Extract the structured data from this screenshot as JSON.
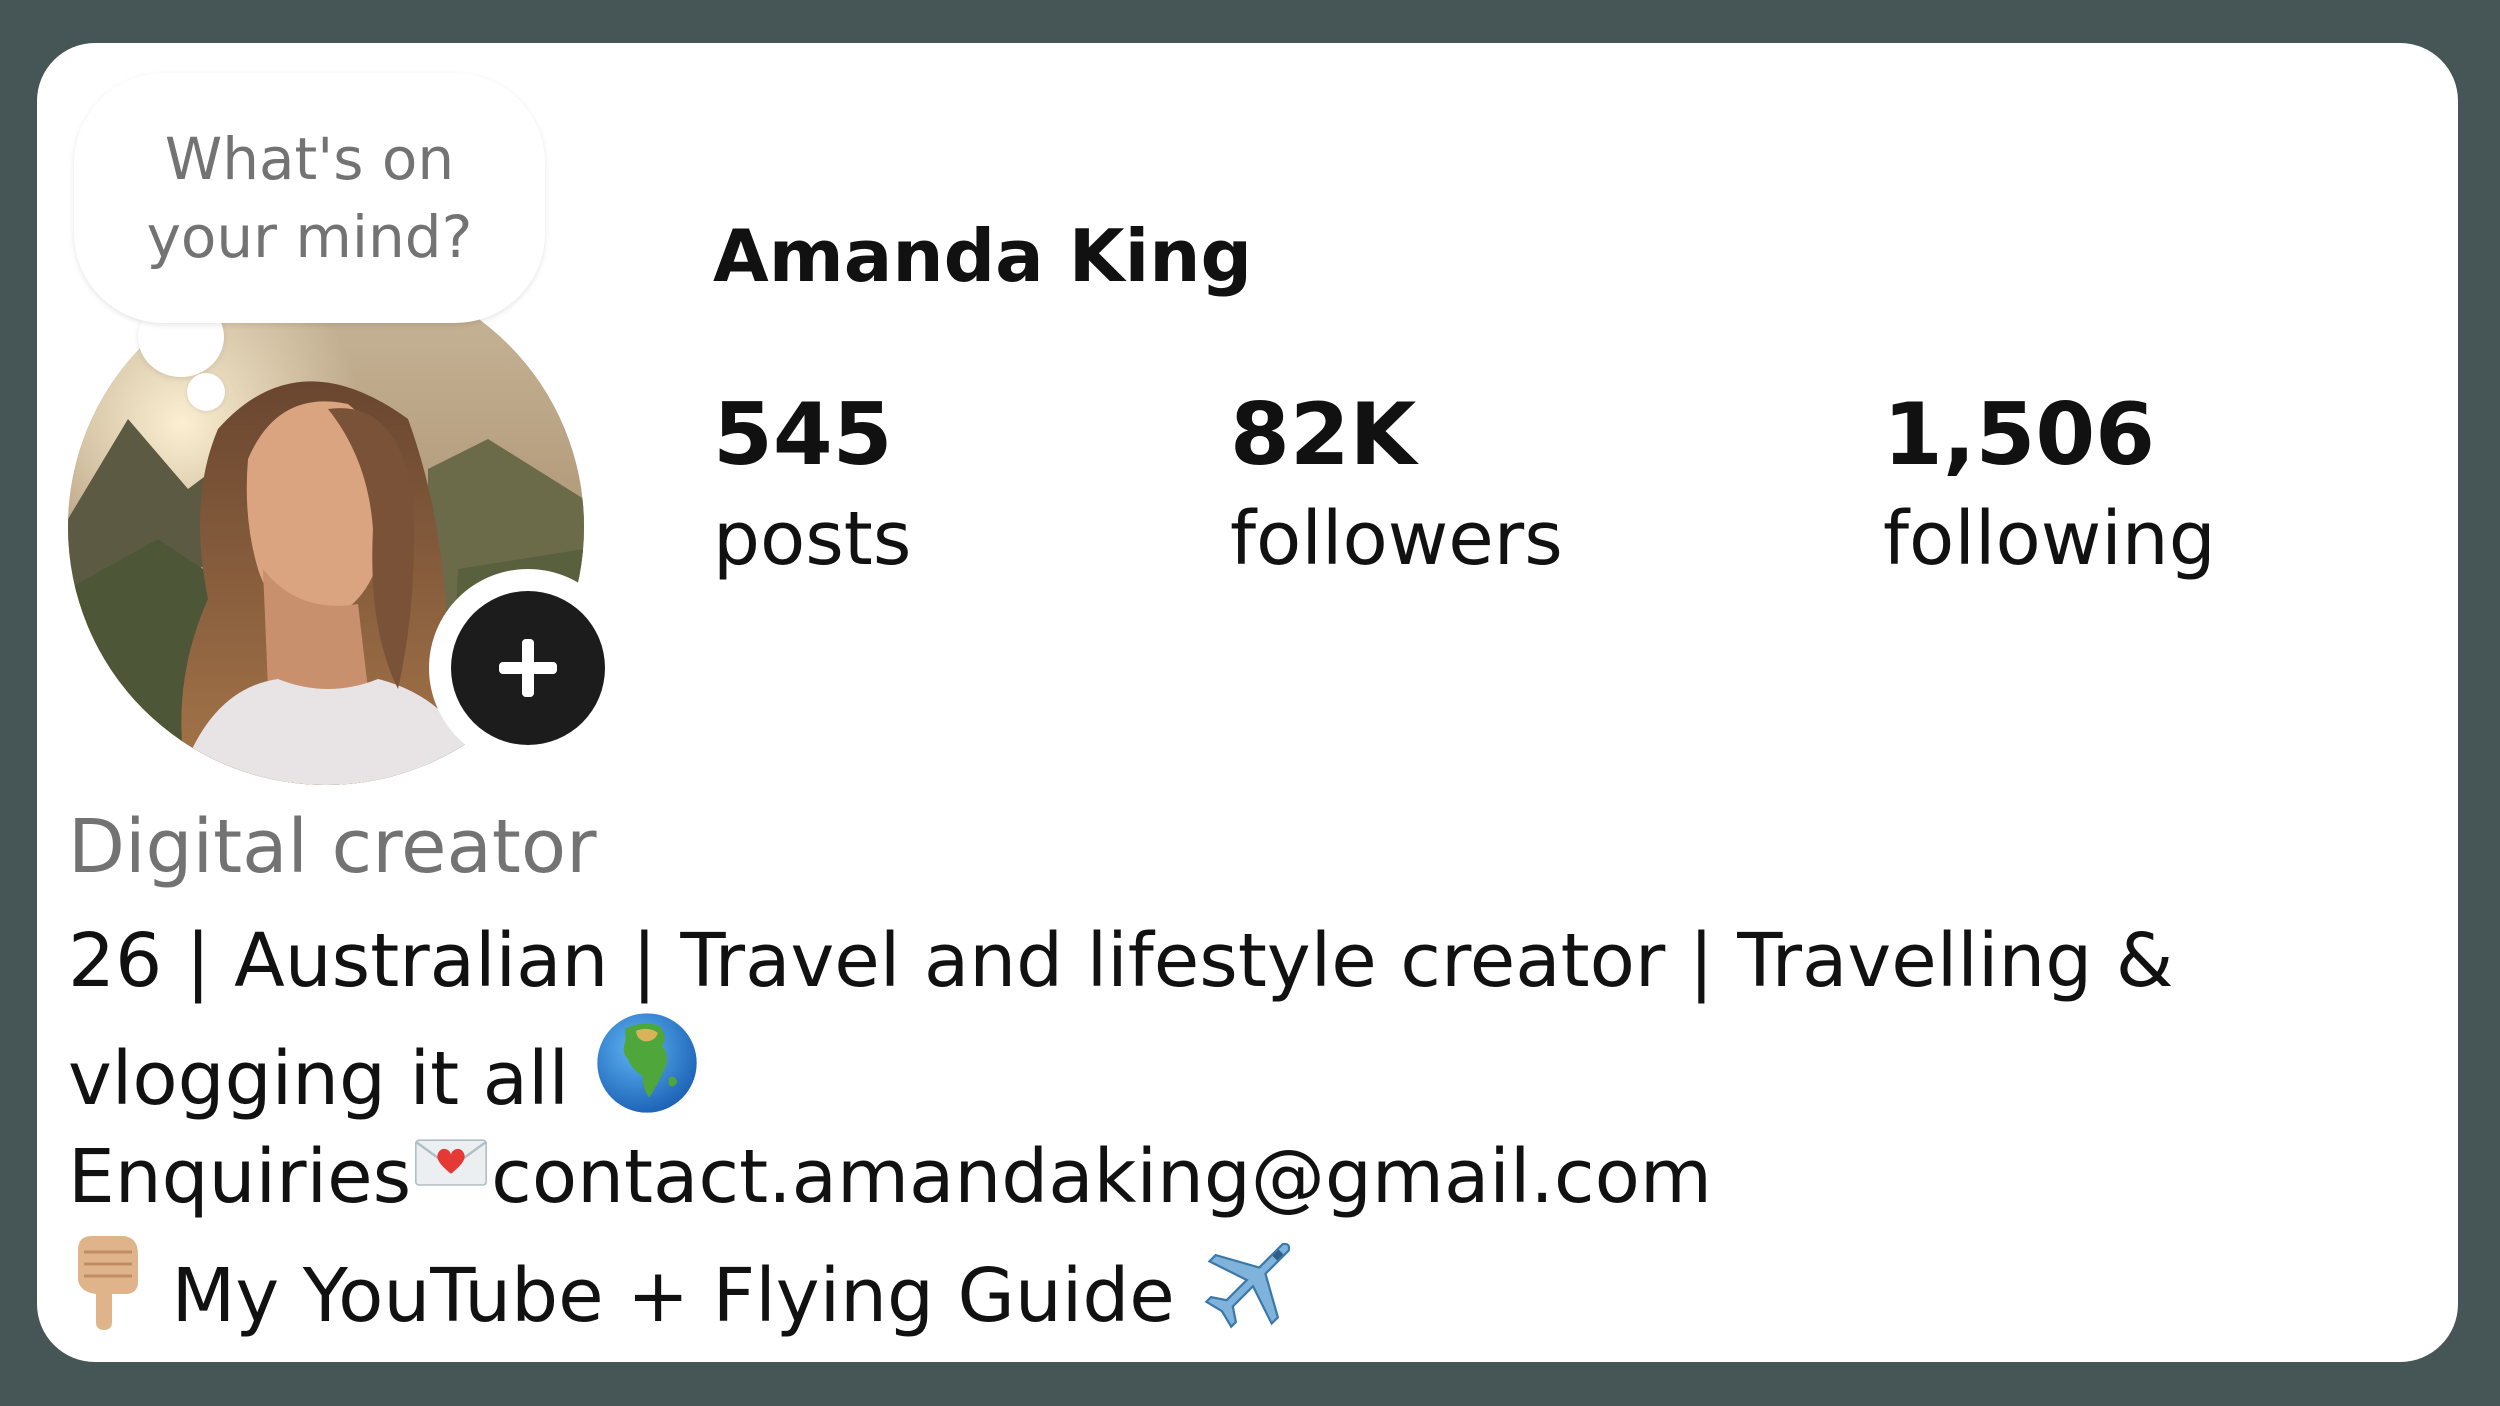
{
  "bubble": {
    "text": "What's on your mind?"
  },
  "profile": {
    "name": "Amanda King",
    "stats": [
      {
        "value": "545",
        "label": "posts"
      },
      {
        "value": "82K",
        "label": "followers"
      },
      {
        "value": "1,506",
        "label": "following"
      }
    ],
    "category": "Digital creator",
    "bio": {
      "line1": "26 | Australian | Travel and lifestyle creator | Travelling &",
      "line2": "vlogging it all",
      "line3_prefix": "Enquiries",
      "line3_email": "contact.amandaking@gmail.com",
      "line4": "My YouTube + Flying Guide"
    }
  },
  "icons": {
    "add": "plus-icon",
    "globe": "globe-africa-icon",
    "envelope": "love-letter-icon",
    "pointer": "pointing-down-icon",
    "plane": "airplane-icon"
  },
  "colors": {
    "frame": "#465556",
    "card": "#ffffff",
    "text": "#111111",
    "muted": "#737373",
    "add_button": "#1c1c1c"
  }
}
